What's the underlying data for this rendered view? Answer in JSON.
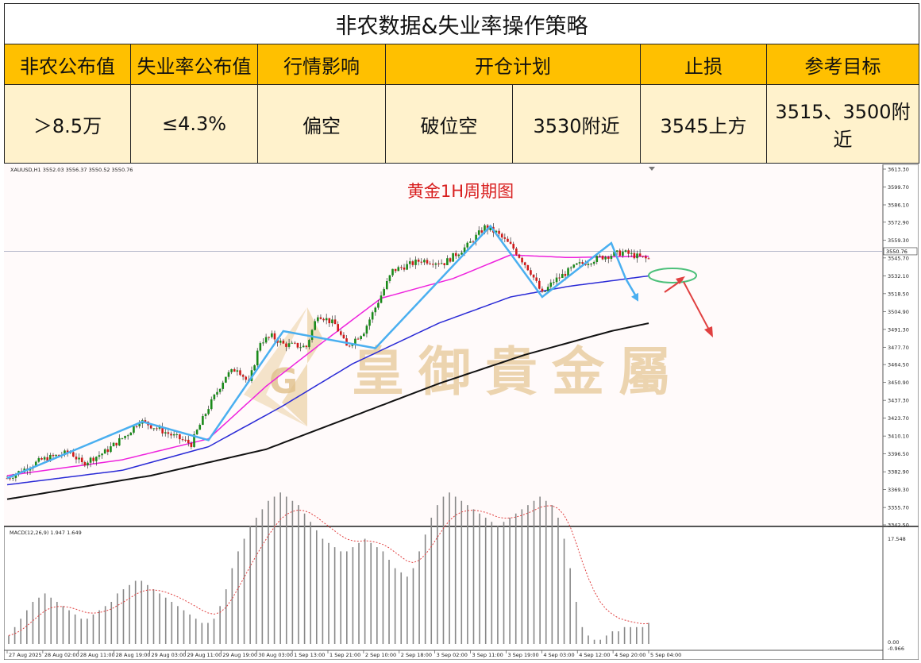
{
  "table": {
    "title": "非农数据&失业率操作策略",
    "headers": [
      "非农公布值",
      "失业率公布值",
      "行情影响",
      "开仓计划",
      "止损",
      "参考目标"
    ],
    "values": [
      "＞8.5万",
      "≤4.3%",
      "偏空",
      "破位空",
      "3530附近",
      "3545上方",
      "3515、3500附近"
    ]
  },
  "chart_data": {
    "type": "candlestick",
    "symbol_info": "XAUUSD,H1  3552.03 3556.37 3550.52 3550.76",
    "title": "黄金1H周期图",
    "watermark": "皇御貴金屬",
    "current_price_label": "3550.76",
    "y_ticks": [
      "3613.30",
      "3599.70",
      "3586.10",
      "3572.90",
      "3559.30",
      "3545.70",
      "3532.10",
      "3518.50",
      "3504.90",
      "3491.30",
      "3477.70",
      "3464.50",
      "3450.90",
      "3437.30",
      "3423.70",
      "3410.10",
      "3396.50",
      "3382.90",
      "3369.30",
      "3355.70",
      "3342.50"
    ],
    "x_ticks": [
      "27 Aug 2025",
      "28 Aug 02:00",
      "28 Aug 11:00",
      "28 Aug 19:00",
      "29 Aug 03:00",
      "29 Aug 11:00",
      "29 Aug 19:00",
      "30 Aug 03:00",
      "1 Sep 13:00",
      "1 Sep 21:00",
      "2 Sep 10:00",
      "2 Sep 18:00",
      "3 Sep 02:00",
      "3 Sep 11:00",
      "3 Sep 19:00",
      "4 Sep 03:00",
      "4 Sep 12:00",
      "4 Sep 20:00",
      "5 Sep 04:00"
    ],
    "ylim": [
      3342.5,
      3613.3
    ],
    "price_path": [
      [
        0,
        3378
      ],
      [
        12,
        3392
      ],
      [
        22,
        3398
      ],
      [
        26,
        3389
      ],
      [
        34,
        3398
      ],
      [
        42,
        3412
      ],
      [
        46,
        3422
      ],
      [
        50,
        3418
      ],
      [
        56,
        3412
      ],
      [
        64,
        3404
      ],
      [
        66,
        3414
      ],
      [
        70,
        3432
      ],
      [
        76,
        3456
      ],
      [
        80,
        3462
      ],
      [
        84,
        3450
      ],
      [
        88,
        3482
      ],
      [
        92,
        3486
      ],
      [
        96,
        3480
      ],
      [
        104,
        3478
      ],
      [
        108,
        3503
      ],
      [
        114,
        3495
      ],
      [
        118,
        3478
      ],
      [
        124,
        3490
      ],
      [
        128,
        3508
      ],
      [
        134,
        3536
      ],
      [
        144,
        3544
      ],
      [
        152,
        3542
      ],
      [
        160,
        3555
      ],
      [
        166,
        3569
      ],
      [
        170,
        3565
      ],
      [
        176,
        3553
      ],
      [
        182,
        3535
      ],
      [
        186,
        3518
      ],
      [
        190,
        3528
      ],
      [
        198,
        3540
      ],
      [
        206,
        3546
      ],
      [
        214,
        3550
      ],
      [
        222,
        3545
      ]
    ],
    "ma_pink": [
      [
        0,
        3380
      ],
      [
        40,
        3392
      ],
      [
        70,
        3408
      ],
      [
        90,
        3448
      ],
      [
        110,
        3482
      ],
      [
        130,
        3515
      ],
      [
        155,
        3530
      ],
      [
        175,
        3548
      ],
      [
        195,
        3546
      ],
      [
        223,
        3547
      ]
    ],
    "ma_blue": [
      [
        0,
        3373
      ],
      [
        40,
        3384
      ],
      [
        70,
        3402
      ],
      [
        95,
        3432
      ],
      [
        120,
        3465
      ],
      [
        150,
        3496
      ],
      [
        175,
        3516
      ],
      [
        195,
        3524
      ],
      [
        223,
        3532
      ]
    ],
    "ma_black": [
      [
        0,
        3362
      ],
      [
        50,
        3380
      ],
      [
        90,
        3400
      ],
      [
        120,
        3425
      ],
      [
        150,
        3450
      ],
      [
        180,
        3472
      ],
      [
        210,
        3490
      ],
      [
        223,
        3496
      ]
    ],
    "zigzag": [
      [
        0,
        3378
      ],
      [
        47,
        3421
      ],
      [
        70,
        3407
      ],
      [
        96,
        3490
      ],
      [
        128,
        3477
      ],
      [
        168,
        3570
      ],
      [
        186,
        3516
      ],
      [
        210,
        3557
      ],
      [
        215,
        3530
      ]
    ],
    "macd_label": "MACD(12,26,9) 1.947 1.649",
    "macd_ticks": [
      "17.548",
      "0.00",
      "-0.966"
    ],
    "macd_hist": [
      2,
      4,
      6,
      8,
      10,
      11,
      12,
      11,
      10,
      9,
      8,
      7,
      6,
      6,
      7,
      8,
      9,
      10,
      12,
      13,
      14,
      15,
      15,
      14,
      13,
      12,
      11,
      10,
      9,
      8,
      7,
      6,
      5,
      5,
      6,
      9,
      13,
      18,
      22,
      25,
      28,
      30,
      32,
      34,
      35,
      36,
      35,
      34,
      33,
      31,
      29,
      27,
      25,
      24,
      23,
      22,
      22,
      23,
      24,
      25,
      24,
      23,
      22,
      20,
      18,
      17,
      16,
      18,
      22,
      26,
      30,
      33,
      35,
      36,
      35,
      34,
      33,
      32,
      31,
      30,
      29,
      28,
      29,
      30,
      31,
      32,
      33,
      34,
      35,
      34,
      33,
      30,
      25,
      18,
      10,
      4,
      2,
      1,
      1,
      2,
      3,
      3,
      4,
      4,
      4,
      4,
      5
    ]
  }
}
